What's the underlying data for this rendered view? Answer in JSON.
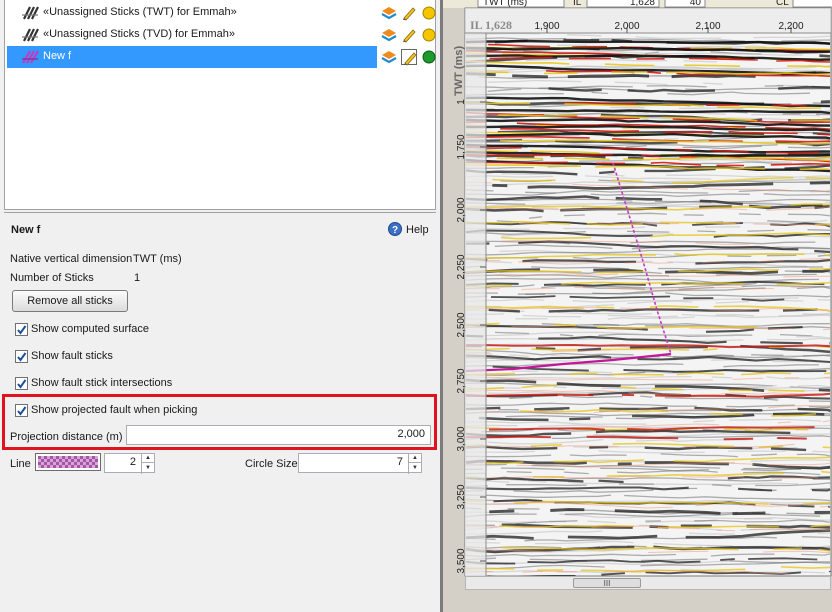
{
  "tree": {
    "items": [
      {
        "label": "«Unassigned Sticks (TWT) for Emmah»",
        "selected": false,
        "status": "yellow"
      },
      {
        "label": "«Unassigned Sticks (TVD) for Emmah»",
        "selected": false,
        "status": "yellow"
      },
      {
        "label": "New f",
        "selected": true,
        "status": "green"
      }
    ]
  },
  "props": {
    "title": "New f",
    "help_label": "Help",
    "native_dim_label": "Native vertical dimension",
    "native_dim_value": "TWT (ms)",
    "num_sticks_label": "Number of Sticks",
    "num_sticks_value": "1",
    "remove_btn": "Remove all sticks",
    "checkboxes": [
      {
        "label": "Show computed surface",
        "checked": true
      },
      {
        "label": "Show fault sticks",
        "checked": true
      },
      {
        "label": "Show fault stick intersections",
        "checked": true
      },
      {
        "label": "Show projected fault when picking",
        "checked": true
      }
    ],
    "projection_label": "Projection distance (m)",
    "projection_value": "2,000",
    "line_label": "Line",
    "line_width": "2",
    "circle_label": "Circle Size",
    "circle_value": "7"
  },
  "viewer": {
    "toolbar": {
      "domain_select": "TWT (ms)",
      "il_label": "IL",
      "il_value": "1,628",
      "step_value": "40",
      "cl_label": "CL"
    },
    "section_label": "IL 1,628",
    "vertical_axis_label": "TWT (ms)",
    "x_ticks": [
      "1,900",
      "2,000",
      "2,100",
      "2,200"
    ],
    "y_ticks": [
      "1",
      "1,750",
      "2,000",
      "2,250",
      "2,500",
      "2,750",
      "3,000",
      "3,250",
      "3,500"
    ],
    "scroll_grip": "III"
  },
  "colors": {
    "selection": "#3399ff",
    "highlight_box": "#e0141e",
    "fault_stick": "#c23bc2",
    "line_swatch": "#a455a4"
  }
}
